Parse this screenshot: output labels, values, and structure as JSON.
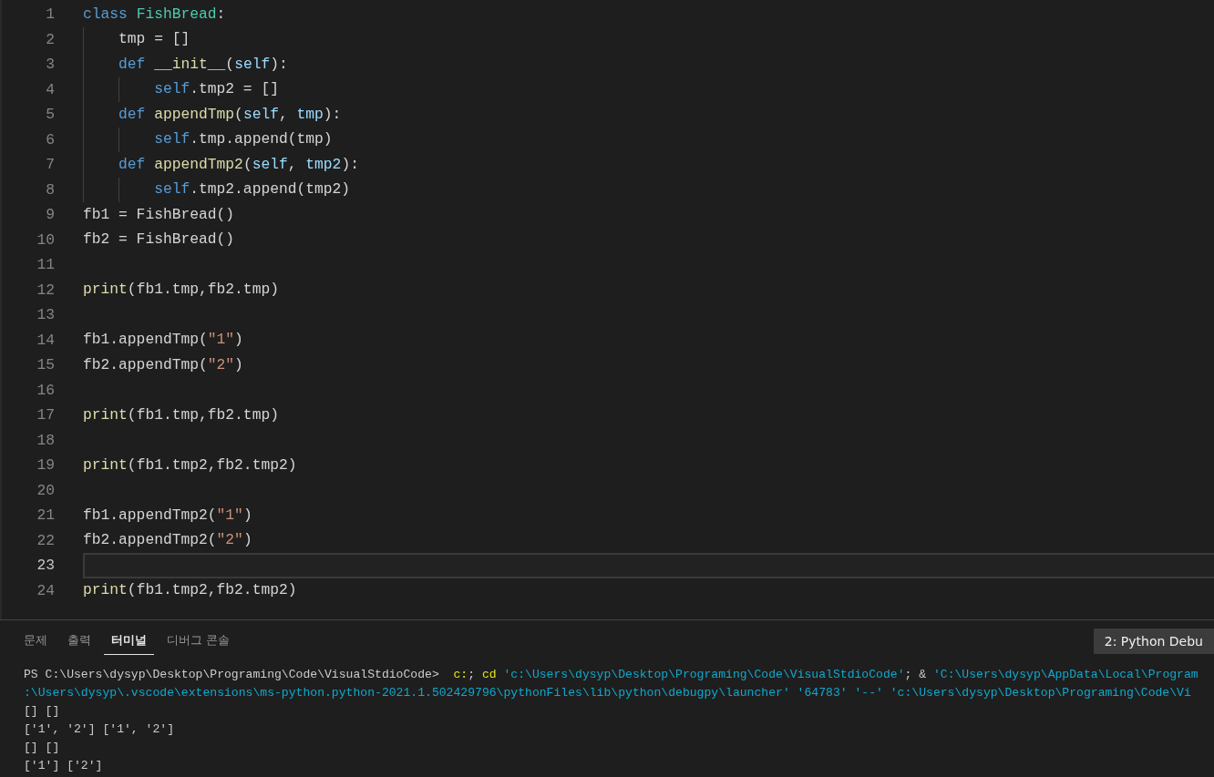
{
  "editor": {
    "lines": [
      {
        "number": "1",
        "current": false,
        "tokens": [
          {
            "kind": "keyword",
            "text": "class "
          },
          {
            "kind": "class",
            "text": "FishBread"
          },
          {
            "kind": "plain",
            "text": ":"
          }
        ]
      },
      {
        "number": "2",
        "current": false,
        "tokens": [
          {
            "kind": "plain",
            "text": "    tmp = []"
          }
        ]
      },
      {
        "number": "3",
        "current": false,
        "tokens": [
          {
            "kind": "keyword",
            "text": "    def "
          },
          {
            "kind": "func",
            "text": "__init__"
          },
          {
            "kind": "plain",
            "text": "("
          },
          {
            "kind": "param",
            "text": "self"
          },
          {
            "kind": "plain",
            "text": "):"
          }
        ]
      },
      {
        "number": "4",
        "current": false,
        "tokens": [
          {
            "kind": "keyword",
            "text": "        self"
          },
          {
            "kind": "plain",
            "text": ".tmp2 = []"
          }
        ]
      },
      {
        "number": "5",
        "current": false,
        "tokens": [
          {
            "kind": "keyword",
            "text": "    def "
          },
          {
            "kind": "func",
            "text": "appendTmp"
          },
          {
            "kind": "plain",
            "text": "("
          },
          {
            "kind": "param",
            "text": "self"
          },
          {
            "kind": "plain",
            "text": ", "
          },
          {
            "kind": "param",
            "text": "tmp"
          },
          {
            "kind": "plain",
            "text": "):"
          }
        ]
      },
      {
        "number": "6",
        "current": false,
        "tokens": [
          {
            "kind": "keyword",
            "text": "        self"
          },
          {
            "kind": "plain",
            "text": ".tmp.append(tmp)"
          }
        ]
      },
      {
        "number": "7",
        "current": false,
        "tokens": [
          {
            "kind": "keyword",
            "text": "    def "
          },
          {
            "kind": "func",
            "text": "appendTmp2"
          },
          {
            "kind": "plain",
            "text": "("
          },
          {
            "kind": "param",
            "text": "self"
          },
          {
            "kind": "plain",
            "text": ", "
          },
          {
            "kind": "param",
            "text": "tmp2"
          },
          {
            "kind": "plain",
            "text": "):"
          }
        ]
      },
      {
        "number": "8",
        "current": false,
        "tokens": [
          {
            "kind": "keyword",
            "text": "        self"
          },
          {
            "kind": "plain",
            "text": ".tmp2.append(tmp2)"
          }
        ]
      },
      {
        "number": "9",
        "current": false,
        "tokens": [
          {
            "kind": "plain",
            "text": "fb1 = FishBread()"
          }
        ]
      },
      {
        "number": "10",
        "current": false,
        "tokens": [
          {
            "kind": "plain",
            "text": "fb2 = FishBread()"
          }
        ]
      },
      {
        "number": "11",
        "current": false
      },
      {
        "number": "12",
        "current": false,
        "tokens": [
          {
            "kind": "func",
            "text": "print"
          },
          {
            "kind": "plain",
            "text": "(fb1.tmp,fb2.tmp)"
          }
        ]
      },
      {
        "number": "13",
        "current": false
      },
      {
        "number": "14",
        "current": false,
        "tokens": [
          {
            "kind": "plain",
            "text": "fb1.appendTmp("
          },
          {
            "kind": "string",
            "text": "\"1\""
          },
          {
            "kind": "plain",
            "text": ")"
          }
        ]
      },
      {
        "number": "15",
        "current": false,
        "tokens": [
          {
            "kind": "plain",
            "text": "fb2.appendTmp("
          },
          {
            "kind": "string",
            "text": "\"2\""
          },
          {
            "kind": "plain",
            "text": ")"
          }
        ]
      },
      {
        "number": "16",
        "current": false
      },
      {
        "number": "17",
        "current": false,
        "tokens": [
          {
            "kind": "func",
            "text": "print"
          },
          {
            "kind": "plain",
            "text": "(fb1.tmp,fb2.tmp)"
          }
        ]
      },
      {
        "number": "18",
        "current": false
      },
      {
        "number": "19",
        "current": false,
        "tokens": [
          {
            "kind": "func",
            "text": "print"
          },
          {
            "kind": "plain",
            "text": "(fb1.tmp2,fb2.tmp2)"
          }
        ]
      },
      {
        "number": "20",
        "current": false
      },
      {
        "number": "21",
        "current": false,
        "tokens": [
          {
            "kind": "plain",
            "text": "fb1.appendTmp2("
          },
          {
            "kind": "string",
            "text": "\"1\""
          },
          {
            "kind": "plain",
            "text": ")"
          }
        ]
      },
      {
        "number": "22",
        "current": false,
        "tokens": [
          {
            "kind": "plain",
            "text": "fb2.appendTmp2("
          },
          {
            "kind": "string",
            "text": "\"2\""
          },
          {
            "kind": "plain",
            "text": ")"
          }
        ]
      },
      {
        "number": "23",
        "current": true
      },
      {
        "number": "24",
        "current": false,
        "tokens": [
          {
            "kind": "func",
            "text": "print"
          },
          {
            "kind": "plain",
            "text": "(fb1.tmp2,fb2.tmp2)"
          }
        ]
      }
    ]
  },
  "panel": {
    "tabs": [
      {
        "label": "문제",
        "selected": false
      },
      {
        "label": "출력",
        "selected": false
      },
      {
        "label": "터미널",
        "selected": true
      },
      {
        "label": "디버그 콘솔",
        "selected": false
      }
    ],
    "terminal_selector": "2: Python Debu",
    "terminal": [
      {
        "tokens": [
          {
            "kind": "plain",
            "text": "PS C:\\Users\\dysyp\\Desktop\\Programing\\Code\\VisualStdioCode>  "
          },
          {
            "kind": "command",
            "text": "c:"
          },
          {
            "kind": "plain",
            "text": "; "
          },
          {
            "kind": "command",
            "text": "cd "
          },
          {
            "kind": "string",
            "text": "'c:\\Users\\dysyp\\Desktop\\Programing\\Code\\VisualStdioCode'"
          },
          {
            "kind": "plain",
            "text": "; & "
          },
          {
            "kind": "string",
            "text": "'C:\\Users\\dysyp\\AppData\\Local\\Program"
          }
        ]
      },
      {
        "tokens": [
          {
            "kind": "string",
            "text": ":\\Users\\dysyp\\.vscode\\extensions\\ms-python.python-2021.1.502429796\\pythonFiles\\lib\\python\\debugpy\\launcher' '64783' '--' 'c:\\Users\\dysyp\\Desktop\\Programing\\Code\\Vi"
          }
        ]
      },
      {
        "tokens": [
          {
            "kind": "plain",
            "text": "[] []"
          }
        ]
      },
      {
        "tokens": [
          {
            "kind": "plain",
            "text": "['1', '2'] ['1', '2']"
          }
        ]
      },
      {
        "tokens": [
          {
            "kind": "plain",
            "text": "[] []"
          }
        ]
      },
      {
        "tokens": [
          {
            "kind": "plain",
            "text": "['1'] ['2']"
          }
        ]
      }
    ]
  }
}
